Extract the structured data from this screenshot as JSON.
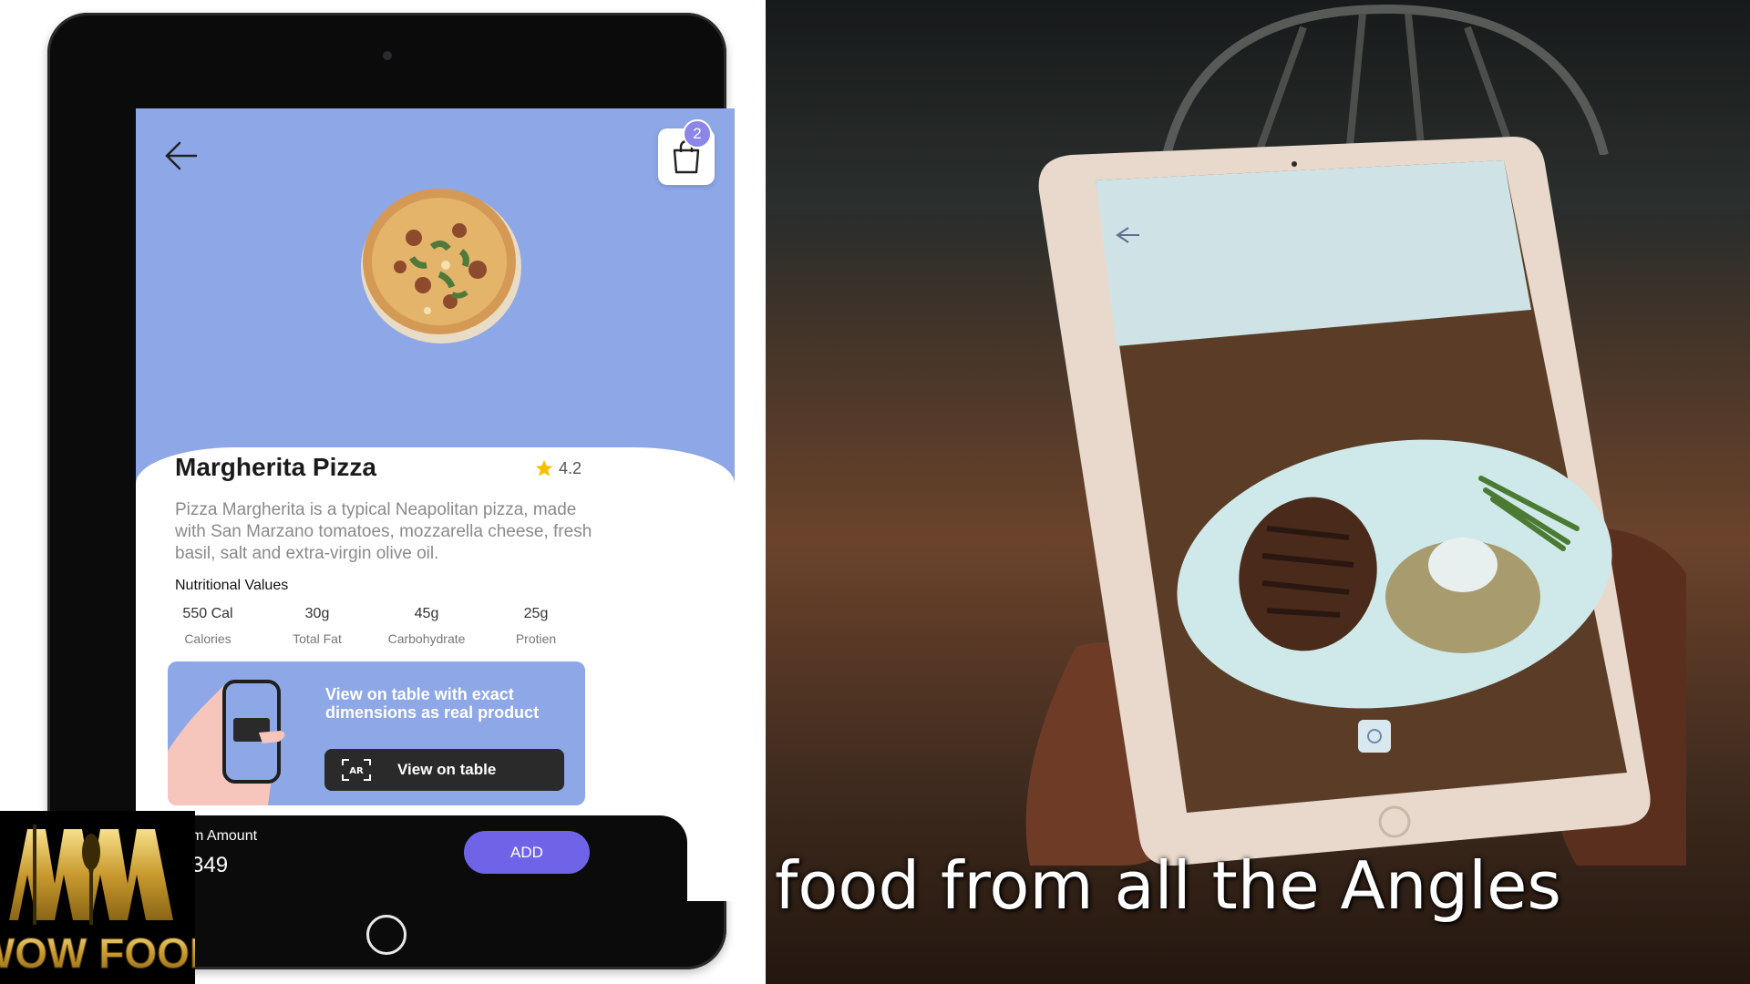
{
  "app": {
    "header": {
      "back_icon": "arrow-left-icon",
      "cart_icon": "shopping-bag-icon",
      "cart_count": "2"
    },
    "product": {
      "name": "Margherita Pizza",
      "rating": "4.2",
      "rating_icon": "star-icon",
      "description": "Pizza Margherita is a typical Neapolitan pizza, made with San Marzano tomatoes, mozzarella cheese, fresh basil, salt and extra-virgin olive oil."
    },
    "nutrition": {
      "heading": "Nutritional Values",
      "items": [
        {
          "value": "550 Cal",
          "label": "Calories"
        },
        {
          "value": "30g",
          "label": "Total Fat"
        },
        {
          "value": "45g",
          "label": "Carbohydrate"
        },
        {
          "value": "25g",
          "label": "Protien"
        }
      ]
    },
    "ar_card": {
      "text": "View on table with exact dimensions as real product",
      "button_label": "View on table",
      "button_icon_text": "AR"
    },
    "footer": {
      "amount_label": "m Amount",
      "amount_value": "349",
      "add_label": "ADD"
    }
  },
  "logo": {
    "text": "WOW FOOD"
  },
  "video": {
    "subtitle": "food from all the Angles"
  },
  "colors": {
    "screen_bg": "#8ea7e6",
    "accent_purple": "#6f64e8",
    "badge_purple": "#8b86e8",
    "star_yellow": "#f6c000"
  }
}
